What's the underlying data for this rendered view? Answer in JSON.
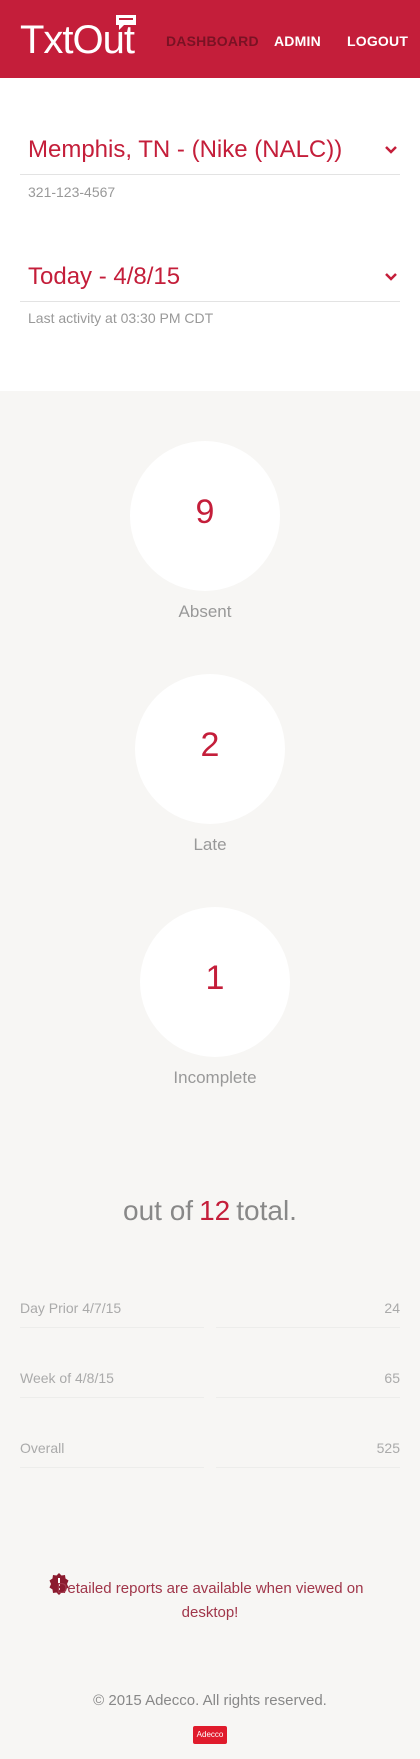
{
  "header": {
    "logo": "TxtOut",
    "nav": [
      {
        "label": "DASHBOARD",
        "active": true
      },
      {
        "label": "ADMIN",
        "active": false
      },
      {
        "label": "LOGOUT",
        "active": false
      }
    ]
  },
  "location": {
    "selected": "Memphis, TN - (Nike (NALC))",
    "phone": "321-123-4567"
  },
  "date": {
    "selected": "Today - 4/8/15",
    "last_activity": "Last activity at 03:30 PM CDT"
  },
  "stats": {
    "absent": {
      "value": "9",
      "label": "Absent"
    },
    "late": {
      "value": "2",
      "label": "Late"
    },
    "incomplete": {
      "value": "1",
      "label": "Incomplete"
    }
  },
  "total": {
    "prefix": "out of",
    "value": "12",
    "suffix": "total."
  },
  "history": [
    {
      "label": "Day Prior 4/7/15",
      "value": "24"
    },
    {
      "label": "Week of 4/8/15",
      "value": "65"
    },
    {
      "label": "Overall",
      "value": "525"
    }
  ],
  "notice": "Detailed reports are available when viewed on desktop!",
  "footer": {
    "copyright": "© 2015 Adecco. All rights reserved.",
    "brand": "Adecco"
  },
  "colors": {
    "accent": "#c41e3a",
    "background": "#f7f6f4"
  },
  "icons": [
    "chevron-down-icon",
    "alert-badge-icon",
    "speech-bubble-icon"
  ]
}
